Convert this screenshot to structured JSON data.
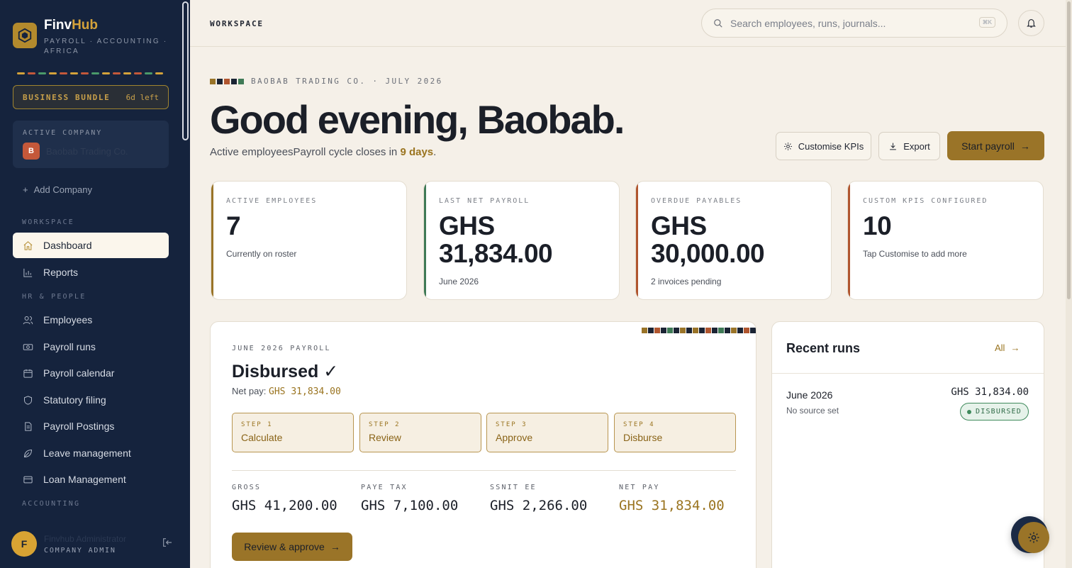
{
  "app": {
    "brand_a": "Finv",
    "brand_b": "Hub",
    "tagline": "PAYROLL · ACCOUNTING · AFRICA"
  },
  "colors": {
    "accent": "#9a7428",
    "sidebar": "#15233d",
    "background": "#f5f0e8",
    "success": "#3f8a5c"
  },
  "sidebar": {
    "bundle": {
      "name": "BUSINESS BUNDLE",
      "days_left": "6d left"
    },
    "active_company": {
      "label": "ACTIVE COMPANY",
      "initial": "B",
      "name": "Baobab Trading Co."
    },
    "add_company": "Add Company",
    "sections": {
      "workspace": "WORKSPACE",
      "hr": "HR & PEOPLE",
      "accounting": "ACCOUNTING"
    },
    "items": [
      {
        "label": "Dashboard",
        "icon": "home-icon"
      },
      {
        "label": "Reports",
        "icon": "chart-icon"
      },
      {
        "label": "Employees",
        "icon": "users-icon"
      },
      {
        "label": "Payroll runs",
        "icon": "cash-icon"
      },
      {
        "label": "Payroll calendar",
        "icon": "calendar-icon"
      },
      {
        "label": "Statutory filing",
        "icon": "shield-icon"
      },
      {
        "label": "Payroll Postings",
        "icon": "document-icon"
      },
      {
        "label": "Leave management",
        "icon": "leaf-icon"
      },
      {
        "label": "Loan Management",
        "icon": "card-icon"
      }
    ],
    "user": {
      "initial": "F",
      "name": "Finvhub Administrator",
      "role": "COMPANY ADMIN"
    }
  },
  "topbar": {
    "title": "WORKSPACE",
    "search_placeholder": "Search employees, runs, journals...",
    "shortcut": "⌘K"
  },
  "hero": {
    "eyebrow": "BAOBAB TRADING CO. · JULY 2026",
    "greeting": "Good evening, Baobab.",
    "subline_prefix": "Active employeesPayroll cycle closes in ",
    "days": "9 days",
    "subline_suffix": ".",
    "buttons": {
      "customise": "Customise KPIs",
      "export": "Export",
      "start": "Start payroll"
    }
  },
  "kpis": [
    {
      "label": "ACTIVE EMPLOYEES",
      "value": "7",
      "note": "Currently on roster",
      "color": "#9a7428"
    },
    {
      "label": "LAST NET PAYROLL",
      "value": "GHS 31,834.00",
      "note": "June 2026",
      "color": "#3f7a56"
    },
    {
      "label": "OVERDUE PAYABLES",
      "value": "GHS 30,000.00",
      "note": "2 invoices pending",
      "color": "#b0562f"
    },
    {
      "label": "CUSTOM KPIS CONFIGURED",
      "value": "10",
      "note": "Tap Customise to add more",
      "color": "#b0562f"
    }
  ],
  "payroll": {
    "eyebrow": "JUNE 2026 PAYROLL",
    "title": "Disbursed ✓",
    "net_label": "Net pay: ",
    "net_value": "GHS 31,834.00",
    "steps": [
      {
        "num": "STEP 1",
        "name": "Calculate"
      },
      {
        "num": "STEP 2",
        "name": "Review"
      },
      {
        "num": "STEP 3",
        "name": "Approve"
      },
      {
        "num": "STEP 4",
        "name": "Disburse"
      }
    ],
    "stats": [
      {
        "label": "GROSS",
        "value": "GHS 41,200.00"
      },
      {
        "label": "PAYE TAX",
        "value": "GHS 7,100.00"
      },
      {
        "label": "SSNIT EE",
        "value": "GHS 2,266.00"
      },
      {
        "label": "NET PAY",
        "value": "GHS 31,834.00"
      }
    ],
    "review_button": "Review & approve"
  },
  "recent_runs": {
    "title": "Recent runs",
    "all_link": "All",
    "items": [
      {
        "month": "June 2026",
        "source": "No source set",
        "amount": "GHS 31,834.00",
        "status": "DISBURSED"
      }
    ]
  }
}
